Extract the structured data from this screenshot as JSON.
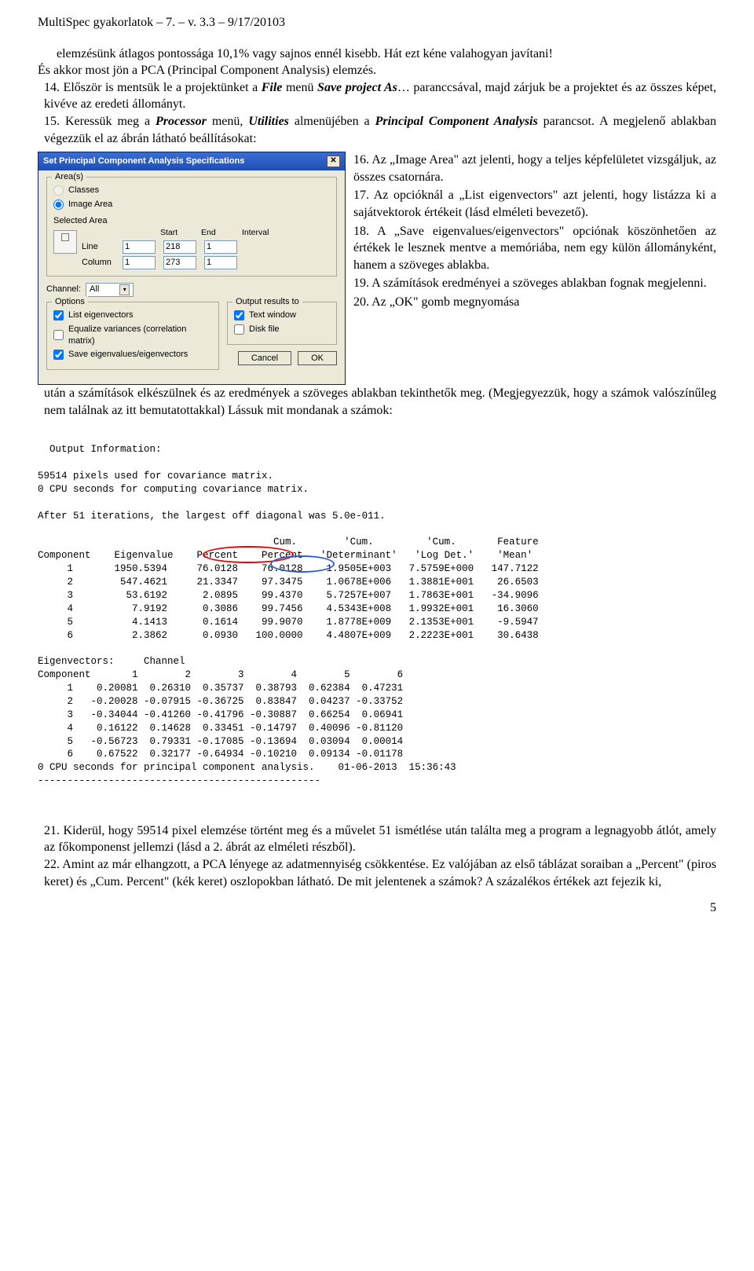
{
  "header": "MultiSpec gyakorlatok – 7. – v. 3.3 – 9/17/20103",
  "intro": {
    "p1": "elemzésünk átlagos pontossága 10,1% vagy sajnos ennél kisebb. Hát ezt kéne valahogyan javítani!",
    "p2": "És akkor most jön a PCA (Principal Component Analysis) elemzés.",
    "p3_prefix": "14. Először is mentsük le a projektünket a ",
    "p3_em1": "File",
    "p3_mid": " menü ",
    "p3_em2": "Save project As",
    "p3_suffix": "… paranccsával, majd zárjuk be a projektet és az összes képet, kivéve az eredeti állományt.",
    "p4_prefix": "15. Keressük meg a ",
    "p4_em1": "Processor",
    "p4_mid1": " menü, ",
    "p4_em2": "Utilities",
    "p4_mid2": " almenüjében a ",
    "p4_em3": "Principal Component Analysis",
    "p4_suffix": " parancsot. A megjelenő ablakban végezzük el az ábrán látható beállításokat:"
  },
  "dialog": {
    "title": "Set Principal Component Analysis Specifications",
    "areas_label": "Area(s)",
    "classes": "Classes",
    "image_area": "Image Area",
    "selected_area": "Selected Area",
    "start": "Start",
    "end": "End",
    "interval": "Interval",
    "line_lbl": "Line",
    "col_lbl": "Column",
    "line_start": "1",
    "line_end": "218",
    "line_int": "1",
    "col_start": "1",
    "col_end": "273",
    "col_int": "1",
    "channel_lbl": "Channel:",
    "channel_val": "All",
    "options_lbl": "Options",
    "opt_list": "List eigenvectors",
    "opt_eq": "Equalize variances (correlation matrix)",
    "opt_save": "Save eigenvalues/eigenvectors",
    "output_lbl": "Output results to",
    "out_text": "Text window",
    "out_disk": "Disk file",
    "cancel": "Cancel",
    "ok": "OK"
  },
  "side": {
    "s16": "16. Az „Image Area\" azt jelenti, hogy a teljes képfelületet vizsgáljuk, az összes csatornára.",
    "s17": "17. Az opcióknál a „List eigenvectors\" azt jelenti, hogy listázza ki a sajátvektorok értékeit (lásd elméleti bevezető).",
    "s18": "18. A „Save eigenvalues/eigenvectors\" opciónak köszönhetően az értékek le lesznek mentve a memóriába, nem egy külön állományként, hanem a szöveges ablakba.",
    "s19": "19. A számítások eredményei a szöveges ablakban fognak megjelenni.",
    "s20a": "20. Az „OK\" gomb megnyomása"
  },
  "s20b": "után a számítások elkészülnek és az eredmények a szöveges ablakban tekinthetők meg. (Megjegyezzük, hogy a számok valószínűleg nem találnak az itt bemutatottakkal) Lássuk mit mondanak a számok:",
  "output_text": "Output Information:\n\n59514 pixels used for covariance matrix.\n0 CPU seconds for computing covariance matrix.\n\nAfter 51 iterations, the largest off diagonal was 5.0e-011.\n\n                                        Cum.        'Cum.         'Cum.       Feature\nComponent    Eigenvalue    Percent    Percent   'Determinant'   'Log Det.'    'Mean'\n     1       1950.5394     76.0128    76.0128    1.9505E+003   7.5759E+000   147.7122\n     2        547.4621     21.3347    97.3475    1.0678E+006   1.3881E+001    26.6503\n     3         53.6192      2.0895    99.4370    5.7257E+007   1.7863E+001   -34.9096\n     4          7.9192      0.3086    99.7456    4.5343E+008   1.9932E+001    16.3060\n     5          4.1413      0.1614    99.9070    1.8778E+009   2.1353E+001    -9.5947\n     6          2.3862      0.0930   100.0000    4.4807E+009   2.2223E+001    30.6438\n\nEigenvectors:     Channel\nComponent       1        2        3        4        5        6\n     1    0.20081  0.26310  0.35737  0.38793  0.62384  0.47231\n     2   -0.20028 -0.07915 -0.36725  0.83847  0.04237 -0.33752\n     3   -0.34044 -0.41260 -0.41796 -0.30887  0.66254  0.06941\n     4    0.16122  0.14628  0.33451 -0.14797  0.40096 -0.81120\n     5   -0.56723  0.79331 -0.17085 -0.13694  0.03094  0.00014\n     6    0.67522  0.32177 -0.64934 -0.10210  0.09134 -0.01178\n0 CPU seconds for principal component analysis.    01-06-2013  15:36:43\n------------------------------------------------",
  "after": {
    "p21": "21. Kiderül, hogy 59514 pixel elemzése történt meg és a művelet 51 ismétlése után találta meg a program a legnagyobb átlót, amely az főkomponenst jellemzi (lásd a 2. ábrát az elméleti részből).",
    "p22": "22. Amint az már elhangzott, a PCA lényege az adatmennyiség csökkentése. Ez valójában az első táblázat soraiban a „Percent\" (piros keret) és „Cum. Percent\" (kék keret) oszlopokban látható. De mit jelentenek a számok? A százalékos értékek azt fejezik ki,"
  },
  "pagenum": "5",
  "chart_data": {
    "type": "table",
    "title": "Principal Component Analysis output",
    "components": [
      {
        "component": 1,
        "eigenvalue": 1950.5394,
        "percent": 76.0128,
        "cum_percent": 76.0128,
        "cum_determinant": "1.9505E+003",
        "cum_log_det": "7.5759E+000",
        "feature_mean": 147.7122
      },
      {
        "component": 2,
        "eigenvalue": 547.4621,
        "percent": 21.3347,
        "cum_percent": 97.3475,
        "cum_determinant": "1.0678E+006",
        "cum_log_det": "1.3881E+001",
        "feature_mean": 26.6503
      },
      {
        "component": 3,
        "eigenvalue": 53.6192,
        "percent": 2.0895,
        "cum_percent": 99.437,
        "cum_determinant": "5.7257E+007",
        "cum_log_det": "1.7863E+001",
        "feature_mean": -34.9096
      },
      {
        "component": 4,
        "eigenvalue": 7.9192,
        "percent": 0.3086,
        "cum_percent": 99.7456,
        "cum_determinant": "4.5343E+008",
        "cum_log_det": "1.9932E+001",
        "feature_mean": 16.306
      },
      {
        "component": 5,
        "eigenvalue": 4.1413,
        "percent": 0.1614,
        "cum_percent": 99.907,
        "cum_determinant": "1.8778E+009",
        "cum_log_det": "2.1353E+001",
        "feature_mean": -9.5947
      },
      {
        "component": 6,
        "eigenvalue": 2.3862,
        "percent": 0.093,
        "cum_percent": 100.0,
        "cum_determinant": "4.4807E+009",
        "cum_log_det": "2.2223E+001",
        "feature_mean": 30.6438
      }
    ],
    "eigenvectors": {
      "channels": [
        1,
        2,
        3,
        4,
        5,
        6
      ],
      "rows": [
        [
          0.20081,
          0.2631,
          0.35737,
          0.38793,
          0.62384,
          0.47231
        ],
        [
          -0.20028,
          -0.07915,
          -0.36725,
          0.83847,
          0.04237,
          -0.33752
        ],
        [
          -0.34044,
          -0.4126,
          -0.41796,
          -0.30887,
          0.66254,
          0.06941
        ],
        [
          0.16122,
          0.14628,
          0.33451,
          -0.14797,
          0.40096,
          -0.8112
        ],
        [
          -0.56723,
          0.79331,
          -0.17085,
          -0.13694,
          0.03094,
          0.00014
        ],
        [
          0.67522,
          0.32177,
          -0.64934,
          -0.1021,
          0.09134,
          -0.01178
        ]
      ]
    },
    "highlights": {
      "red_ellipse_column": "Percent",
      "blue_ellipse_column": "Cum. Percent"
    }
  }
}
